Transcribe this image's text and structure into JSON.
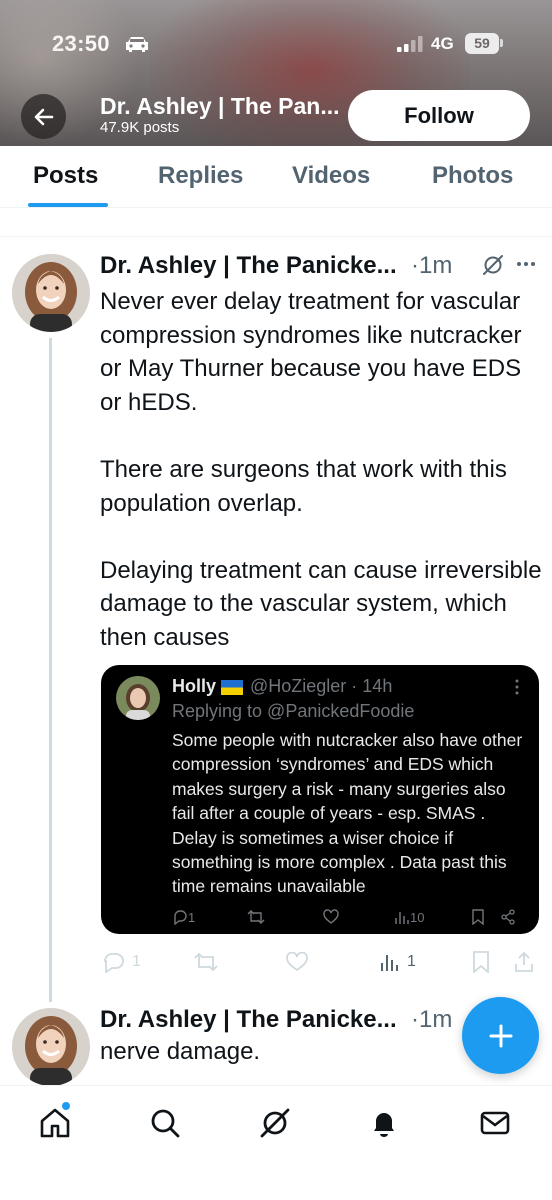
{
  "status_bar": {
    "time": "23:50",
    "network": "4G",
    "battery": "59"
  },
  "header": {
    "profile_name": "Dr. Ashley | The Pan...",
    "post_count": "47.9K posts",
    "follow_label": "Follow",
    "back_icon": "arrow-left-icon"
  },
  "tabs": [
    {
      "label": "Posts",
      "active": true
    },
    {
      "label": "Replies",
      "active": false
    },
    {
      "label": "Videos",
      "active": false
    },
    {
      "label": "Photos",
      "active": false
    }
  ],
  "tweet": {
    "author": "Dr. Ashley | The Panicke...",
    "time": "·1m",
    "paragraphs": [
      "Never ever delay treatment for vascular compression syndromes like nutcracker or May Thurner because you have EDS or hEDS.",
      "There are surgeons that work with this population overlap.",
      "Delaying treatment can cause irreversible damage to the vascular system, which then causes"
    ],
    "actions": {
      "replies": "1",
      "reposts": "",
      "likes": "",
      "views": "1"
    }
  },
  "quote": {
    "name": "Holly",
    "handle": "@HoZiegler · 14h",
    "replying_to": "Replying to @PanickedFoodie",
    "text": "Some people with nutcracker also have other compression ‘syndromes’ and EDS which makes surgery a risk - many surgeries also fail after a couple of years - esp. SMAS . Delay is sometimes a wiser choice if something is more complex . Data past this time remains unavailable",
    "actions": {
      "replies": "1",
      "views": "10"
    }
  },
  "tweet2": {
    "author": "Dr. Ashley | The Panicke...",
    "time": "·1m",
    "text": "nerve damage."
  },
  "colors": {
    "accent": "#1d9bf0",
    "text": "#0f1419",
    "muted": "#536471"
  },
  "bottom_nav": [
    "home-icon",
    "search-icon",
    "grok-icon",
    "notifications-icon",
    "messages-icon"
  ]
}
